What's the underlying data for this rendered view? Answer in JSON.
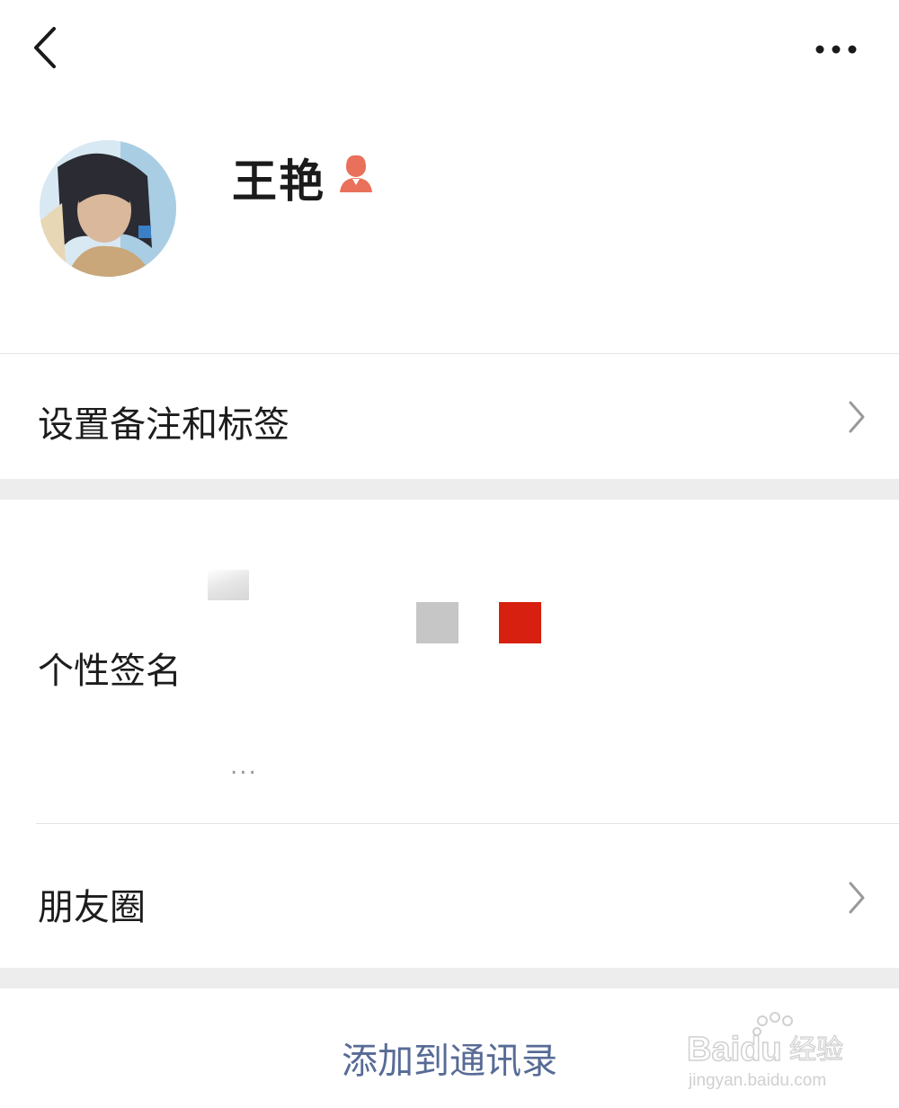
{
  "header": {
    "back_icon": "chevron-left-icon",
    "more_icon": "more-dots-icon"
  },
  "profile": {
    "name": "王艳",
    "gender_icon": "female-user-icon",
    "gender_color": "#e9705a"
  },
  "rows": {
    "remark_tags": "设置备注和标签",
    "signature": "个性签名",
    "signature_ellipsis": "...",
    "moments": "朋友圈"
  },
  "actions": {
    "add_to_contacts": "添加到通讯录",
    "link_color": "#576b95"
  },
  "watermark": {
    "brand": "Baidu",
    "brand_cn": "经验",
    "url": "jingyan.baidu.com"
  },
  "colors": {
    "gap_bg": "#ededed",
    "mosaic_red": "#d7200f",
    "mosaic_gray": "#c6c6c6"
  }
}
